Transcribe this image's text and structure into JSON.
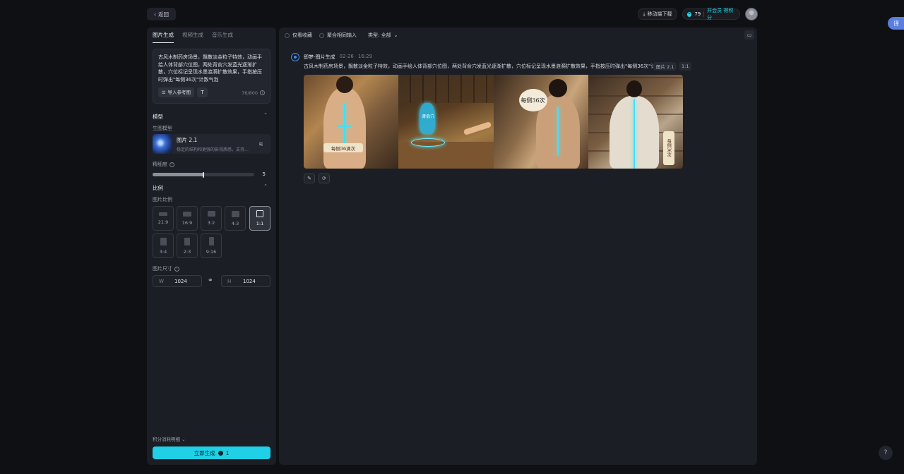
{
  "topbar": {
    "back_label": "返回",
    "mobile_download_label": "移动端下载",
    "points": "79",
    "vip_label": "开会员 得积分"
  },
  "translate_badge": "译",
  "left": {
    "tabs": [
      "图片生成",
      "视频生成",
      "音乐生成"
    ],
    "prompt": "古风木制药房场景，飘散淡金粒子特效，动画手绘人体背部穴位图，两处背俞穴发蓝光逐渐扩散，穴位标记呈现水墨涟漪扩散效果，手指按压时弹出\"每侧36次\"计数气泡",
    "ref_image_label": "导入参考图",
    "t_label": "T",
    "char_count": "76/800",
    "model_section": "模型",
    "gen_model_label": "生图模型",
    "model_name": "图片 2.1",
    "model_desc": "稳定的结构和更强的影视质感，支持…",
    "precision_label": "精细度",
    "precision_value": "5",
    "precision_fraction": 0.5,
    "ratio_section": "比例",
    "ratio_label": "图片比例",
    "ratios": [
      "21:9",
      "16:9",
      "3:2",
      "4:3",
      "1:1",
      "3:4",
      "2:3",
      "9:16"
    ],
    "selected_ratio": "1:1",
    "size_label": "图片尺寸",
    "width_label": "W",
    "width_value": "1024",
    "height_label": "H",
    "height_value": "1024",
    "credits_detail": "积分消耗明细",
    "generate_label": "立即生成",
    "generate_cost": "1"
  },
  "main": {
    "filter_favorites": "仅看收藏",
    "filter_merge": "聚合相同输入",
    "type_filter": "类型: 全部",
    "message": {
      "name": "即梦-图片生成",
      "date": "02-26",
      "time": "16:29",
      "prompt": "古风木制药房场景，飘散淡金粒子特效，动画手绘人体背部穴位图，两处背俞穴发蓝光逐渐扩散，穴位标记呈现水墨涟漪扩散效果，手指按压时弹出\"每侧36次\"计数气泡",
      "model_tag": "图片 2.1",
      "ratio_tag": "1:1",
      "image_texts": [
        "每侧36滴次",
        "肾俞穴",
        "每侧36次",
        "每侧36次"
      ]
    }
  },
  "help_label": "?"
}
